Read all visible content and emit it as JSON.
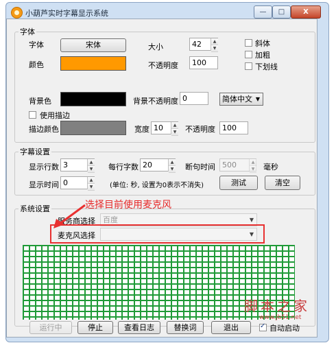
{
  "window": {
    "title": "小葫芦实时字幕显示系统",
    "min": "—",
    "max": "□",
    "close": "X"
  },
  "font_group": {
    "legend": "字体",
    "font_label": "字体",
    "font_button": "宋体",
    "color_label": "颜色",
    "color": "#FF9900",
    "size_label": "大小",
    "size_value": "42",
    "opacity_label": "不透明度",
    "opacity_value": "100",
    "italic_label": "斜体",
    "bold_label": "加粗",
    "underline_label": "下划线",
    "bg_color_label": "背景色",
    "bg_color": "#000000",
    "bg_opacity_label": "背景不透明度",
    "bg_opacity_value": "0",
    "language_value": "简体中文",
    "use_stroke_label": "使用描边",
    "stroke_color_label": "描边颜色",
    "stroke_color": "#808080",
    "width_label": "宽度",
    "width_value": "10",
    "stroke_opacity_label": "不透明度",
    "stroke_opacity_value": "100"
  },
  "subtitle_group": {
    "legend": "字幕设置",
    "rows_label": "显示行数",
    "rows_value": "3",
    "chars_label": "每行字数",
    "chars_value": "20",
    "pause_label": "断句时间",
    "pause_value": "500",
    "pause_unit": "毫秒",
    "time_label": "显示时间",
    "time_value": "0",
    "hint": "(单位: 秒, 设置为0表示不消失)",
    "test_button": "测试",
    "clear_button": "清空"
  },
  "system_group": {
    "legend": "系统设置",
    "vendor_label": "服务商选择",
    "vendor_value": "百度",
    "mic_label": "麦克风选择",
    "mic_value": ""
  },
  "annotation": {
    "text": "选择目前使用麦克风"
  },
  "bottom": {
    "running": "运行中",
    "stop": "停止",
    "view_log": "查看日志",
    "replace": "替换词",
    "exit": "退出",
    "autostart_label": "自动启动"
  },
  "watermark": {
    "text": "脚本之家",
    "url": "www.jb51.net"
  },
  "colors": {
    "accent": "#E83030",
    "grid": "#1F9A37"
  }
}
